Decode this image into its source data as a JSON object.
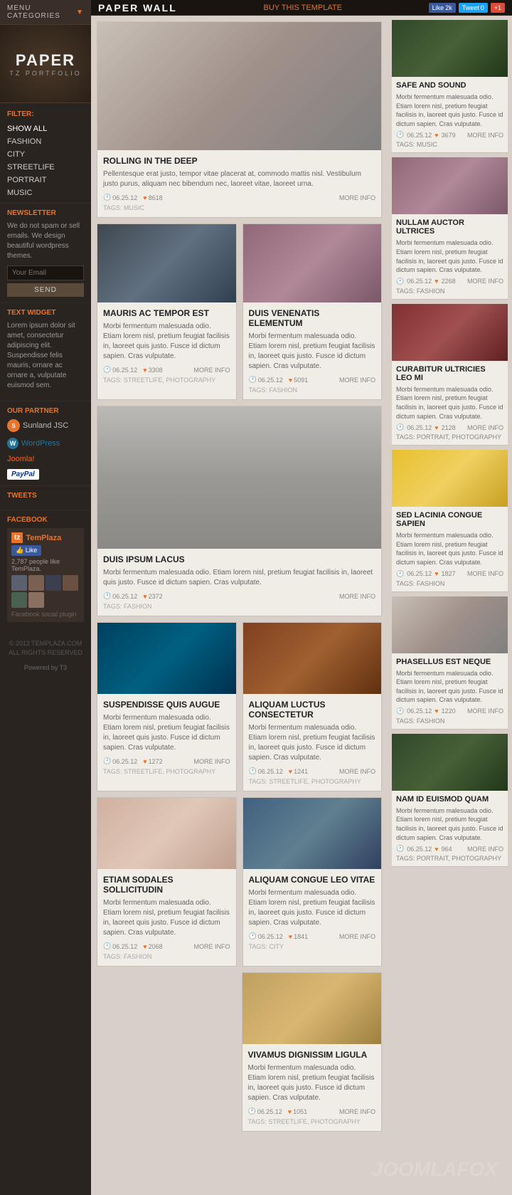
{
  "header": {
    "title": "PAPER WALL",
    "buy_label": "BUY THIS TEMPLATE",
    "social": {
      "facebook_label": "Like",
      "facebook_count": "2k",
      "twitter_label": "Tweet",
      "twitter_count": "0",
      "gplus_label": "+1"
    }
  },
  "sidebar": {
    "menu_label": "MENU CATEGORIES",
    "logo_text": "PAPER",
    "logo_sub": "TZ PORTFOLIO",
    "filter_label": "FILTER:",
    "filter_items": [
      {
        "label": "SHOW ALL",
        "active": true
      },
      {
        "label": "FASHION"
      },
      {
        "label": "CITY"
      },
      {
        "label": "STREETLIFE"
      },
      {
        "label": "PORTRAIT"
      },
      {
        "label": "MUSIC"
      }
    ],
    "newsletter_label": "NEWSLETTER",
    "newsletter_desc": "We do not spam or sell emails. We design beautiful wordpress themes.",
    "newsletter_placeholder": "Your Email",
    "newsletter_btn": "SEND",
    "text_widget_label": "TEXT WIDGET",
    "text_widget_content": "Lorem ipsum dolor sit amet, consectetur adipiscing elit. Suspendisse felis mauris, ornare ac ornare a, vulputate euismod sem.",
    "partners_label": "OUR PARTNER",
    "partners": [
      {
        "name": "Sunland JSC"
      },
      {
        "name": "WordPress"
      },
      {
        "name": "Joomla!"
      },
      {
        "name": "PayPal"
      }
    ],
    "tweets_label": "TWEETS",
    "facebook_label": "FACEBOOK",
    "fb_page": "TemPlaza",
    "fb_likes_count": "2,787 people like TemPlaza.",
    "fb_plugin_label": "Facebook social plugin",
    "footer_copy": "© 2012 TEMPLAZA.COM\nALL RIGHTS RESERVED",
    "powered_by": "Powered by T3"
  },
  "main": {
    "posts": [
      {
        "id": "rolling",
        "title": "ROLLING IN THE DEEP",
        "excerpt": "Pellentesque erat justo, tempor vitae placerat at, commodo mattis nisl. Vestibulum justo purus, aliquam nec bibendum nec, laoreet vitae, laoreet urna.",
        "date": "06.25.12",
        "likes": "8618",
        "tags": "MUSIC",
        "img_class": "img-portrait",
        "height": "180",
        "wide": true
      },
      {
        "id": "mauris",
        "title": "MAURIS AC TEMPOR EST",
        "excerpt": "Morbi fermentum malesuada odio. Etiam lorem nisl, pretium feugiat facilisis in, laoreet quis justo. Fusce id dictum sapien. Cras vulputate.",
        "date": "06.25.12",
        "likes": "3308",
        "tags": "STREETLIFE, PHOTOGRAPHY",
        "img_class": "img-city",
        "height": "110",
        "wide": false
      },
      {
        "id": "duis_venenatis",
        "title": "DUIS VENENATIS ELEMENTUM",
        "excerpt": "Morbi fermentum malesuada odio. Etiam lorem nisl, pretium feugiat facilisis in, laoreet quis justo. Fusce id dictum sapien. Cras vulputate.",
        "date": "06.25.12",
        "likes": "5091",
        "tags": "FASHION",
        "img_class": "img-fashion",
        "height": "110",
        "wide": false
      },
      {
        "id": "duis_ipsum",
        "title": "DUIS IPSUM LACUS",
        "excerpt": "Morbi fermentum malesuada odio. Etiam lorem nisl, pretium feugiat facilisis in, laoreet quis justo. Fusce id dictum sapien. Cras vulputate.",
        "date": "06.25.12",
        "likes": "2372",
        "tags": "FASHION",
        "img_class": "img-portrait",
        "height": "200",
        "wide": true
      },
      {
        "id": "suspendisse",
        "title": "SUSPENDISSE QUIS AUGUE",
        "excerpt": "Morbi fermentum malesuada odio. Etiam lorem nisl, pretium feugiat facilisis in, laoreet quis justo. Fusce id dictum sapien. Cras vulputate.",
        "date": "06.25.12",
        "likes": "1272",
        "tags": "STREETLIFE, PHOTOGRAPHY",
        "img_class": "img-underwater",
        "height": "100",
        "wide": false
      },
      {
        "id": "aliquam_luctus",
        "title": "ALIQUAM LUCTUS CONSECTETUR",
        "excerpt": "Morbi fermentum malesuada odio. Etiam lorem nisl, pretium feugiat facilisis in, laoreet quis justo. Fusce id dictum sapien. Cras vulputate.",
        "date": "06.25.12",
        "likes": "1241",
        "tags": "STREETLIFE, PHOTOGRAPHY",
        "img_class": "img-autumn",
        "height": "100",
        "wide": false
      },
      {
        "id": "etiam",
        "title": "ETIAM SODALES SOLLICITUDIN",
        "excerpt": "Morbi fermentum malesuada odio. Etiam lorem nisl, pretium feugiat facilisis in, laoreet quis justo. Fusce id dictum sapien. Cras vulputate.",
        "date": "06.25.12",
        "likes": "2068",
        "tags": "FASHION",
        "img_class": "img-women",
        "height": "100",
        "wide": false
      },
      {
        "id": "aliquam_congue",
        "title": "ALIQUAM CONGUE LEO VITAE",
        "excerpt": "Morbi fermentum malesuada odio. Etiam lorem nisl, pretium feugiat facilisis in, laoreet quis justo. Fusce id dictum sapien. Cras vulputate.",
        "date": "06.25.12",
        "likes": "1841",
        "tags": "CITY",
        "img_class": "img-castle",
        "height": "100",
        "wide": false
      },
      {
        "id": "vivamus",
        "title": "VIVAMUS DIGNISSIM LIGULA",
        "excerpt": "Morbi fermentum malesuada odio. Etiam lorem nisl, pretium feugiat facilisis in, laoreet quis justo. Fusce id dictum sapien. Cras vulputate.",
        "date": "06.25.12",
        "likes": "1051",
        "tags": "STREETLIFE, PHOTOGRAPHY",
        "img_class": "img-street2",
        "height": "100",
        "wide": false
      }
    ]
  },
  "right_sidebar": {
    "posts": [
      {
        "id": "safe_sound",
        "title": "SAFE AND SOUND",
        "excerpt": "Morbi fermentum malesuada odio. Etiam lorem nisl, pretium feugiat facilisis in, laoreet quis justo. Fusce id dictum sapien. Cras vulputate.",
        "date": "06.25.12",
        "likes": "3679",
        "tags": "MUSIC",
        "img_class": "img-forest"
      },
      {
        "id": "nullam",
        "title": "NULLAM AUCTOR ULTRICES",
        "excerpt": "Morbi fermentum malesuada odio. Etiam lorem nisl, pretium feugiat facilisis in, laoreet quis justo. Fusce id dictum sapien. Cras vulputate.",
        "date": "06.25.12",
        "likes": "2268",
        "tags": "FASHION",
        "img_class": "img-fashion"
      },
      {
        "id": "curabitur",
        "title": "CURABITUR ULTRICIES LEO MI",
        "excerpt": "Morbi fermentum malesuada odio. Etiam lorem nisl, pretium feugiat facilisis in, laoreet quis justo. Fusce id dictum sapien. Cras vulputate.",
        "date": "06.25.12",
        "likes": "2128",
        "tags": "PORTRAIT, PHOTOGRAPHY",
        "img_class": "img-red"
      },
      {
        "id": "sed_lacinia",
        "title": "SED LACINIA CONGUE SAPIEN",
        "excerpt": "Morbi fermentum malesuada odio. Etiam lorem nisl, pretium feugiat facilisis in, laoreet quis justo. Fusce id dictum sapien. Cras vulputate.",
        "date": "06.25.12",
        "likes": "1827",
        "tags": "FASHION",
        "img_class": "img-prada"
      },
      {
        "id": "phasellus",
        "title": "PHASELLUS EST NEQUE",
        "excerpt": "Morbi fermentum malesuada odio. Etiam lorem nisl, pretium feugiat facilisis in, laoreet quis justo. Fusce id dictum sapien. Cras vulputate.",
        "date": "06.25.12",
        "likes": "1220",
        "tags": "FASHION",
        "img_class": "img-portrait"
      },
      {
        "id": "nam_id",
        "title": "NAM ID EUISMOD QUAM",
        "excerpt": "Morbi fermentum malesuada odio. Etiam lorem nisl, pretium feugiat facilisis in, laoreet quis justo. Fusce id dictum sapien. Cras vulputate.",
        "date": "06.25.12",
        "likes": "964",
        "tags": "PORTRAIT, PHOTOGRAPHY",
        "img_class": "img-forest"
      }
    ]
  },
  "labels": {
    "more_info": "MORE INFO",
    "tags_prefix": "TAGS:",
    "date_icon": "🕐",
    "heart_icon": "♥",
    "comment_icon": "💬"
  }
}
